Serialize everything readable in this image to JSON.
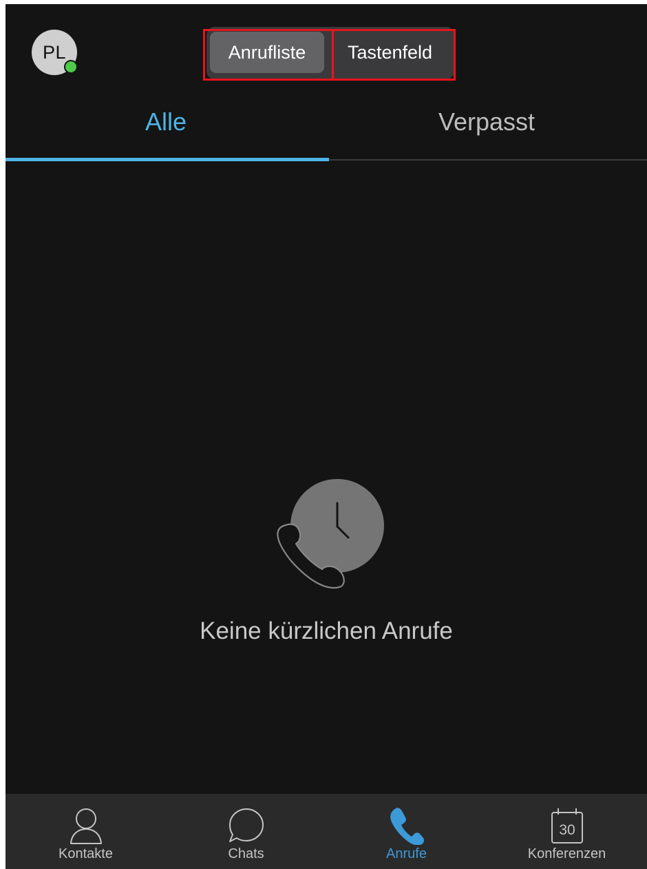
{
  "header": {
    "avatar_initials": "PL",
    "presence_status_color": "#4fc94a",
    "segments": [
      {
        "label": "Anrufliste",
        "selected": true
      },
      {
        "label": "Tastenfeld",
        "selected": false
      }
    ]
  },
  "tabs": [
    {
      "label": "Alle",
      "active": true
    },
    {
      "label": "Verpasst",
      "active": false
    }
  ],
  "empty_state": {
    "icon": "recent-calls-clock-icon",
    "message": "Keine kürzlichen Anrufe"
  },
  "bottom_nav": [
    {
      "label": "Kontakte",
      "icon": "person-icon",
      "active": false
    },
    {
      "label": "Chats",
      "icon": "chat-bubble-icon",
      "active": false
    },
    {
      "label": "Anrufe",
      "icon": "phone-icon",
      "active": true
    },
    {
      "label": "Konferenzen",
      "icon": "calendar-icon",
      "active": false,
      "icon_text": "30"
    }
  ],
  "colors": {
    "accent": "#4fb4e6",
    "background": "#141414",
    "highlight_box": "#e8141b"
  }
}
